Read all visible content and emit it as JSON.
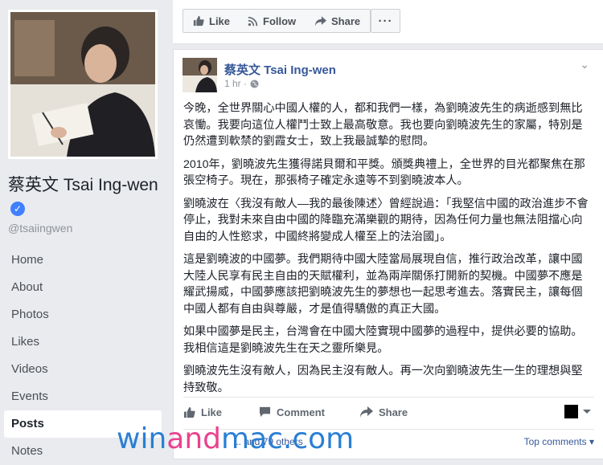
{
  "sidebar": {
    "page_name": "蔡英文 Tsai Ing-wen",
    "handle": "@tsaiingwen",
    "nav": [
      {
        "label": "Home"
      },
      {
        "label": "About"
      },
      {
        "label": "Photos"
      },
      {
        "label": "Likes"
      },
      {
        "label": "Videos"
      },
      {
        "label": "Events"
      },
      {
        "label": "Posts"
      },
      {
        "label": "Notes"
      }
    ],
    "active_item": "Posts"
  },
  "actionbar": {
    "like_label": "Like",
    "follow_label": "Follow",
    "share_label": "Share",
    "more_label": "···"
  },
  "post": {
    "author": "蔡英文 Tsai Ing-wen",
    "time": "1 hr ·",
    "paragraphs": [
      "今晚，全世界關心中國人權的人，都和我們一樣，為劉曉波先生的病逝感到無比哀慟。我要向這位人權鬥士致上最高敬意。我也要向劉曉波先生的家屬，特別是仍然遭到軟禁的劉霞女士，致上我最誠摯的慰問。",
      "2010年，劉曉波先生獲得諾貝爾和平獎。頒獎典禮上，全世界的目光都聚焦在那張空椅子。現在，那張椅子確定永遠等不到劉曉波本人。",
      "劉曉波在〈我沒有敵人—我的最後陳述〉曾經說過：「我堅信中國的政治進步不會停止，我對未來自由中國的降臨充滿樂觀的期待，因為任何力量也無法阻擋心向自由的人性慾求，中國終將變成人權至上的法治國」。",
      "這是劉曉波的中國夢。我們期待中國大陸當局展現自信，推行政治改革，讓中國大陸人民享有民主自由的天賦權利，並為兩岸關係打開新的契機。中國夢不應是耀武揚威，中國夢應該把劉曉波先生的夢想也一起思考進去。落實民主，讓每個中國人都有自由與尊嚴，才是值得驕傲的真正大國。",
      "如果中國夢是民主，台灣會在中國大陸實現中國夢的過程中，提供必要的協助。我相信這是劉曉波先生在天之靈所樂見。",
      "劉曉波先生沒有敵人，因為民主沒有敵人。再一次向劉曉波先生一生的理想與堅持致敬。"
    ],
    "actions": {
      "like_label": "Like",
      "comment_label": "Comment",
      "share_label": "Share"
    },
    "reactions_text": "... and 79 others",
    "top_comments_label": "Top comments ▾"
  },
  "watermark": {
    "part1": "win",
    "part2": "and",
    "part3": "mac.com"
  },
  "colors": {
    "facebook_blue": "#365899",
    "background": "#e9ebee",
    "verified_badge": "#4080ff",
    "watermark_blue": "#2a7fd4",
    "watermark_pink": "#e8438e"
  },
  "icons": {
    "verified": "verified-badge-icon",
    "like": "thumbs-up-icon",
    "follow": "rss-icon",
    "share": "share-arrow-icon",
    "comment": "speech-bubble-icon",
    "globe": "globe-icon",
    "chevron": "chevron-down-icon"
  }
}
